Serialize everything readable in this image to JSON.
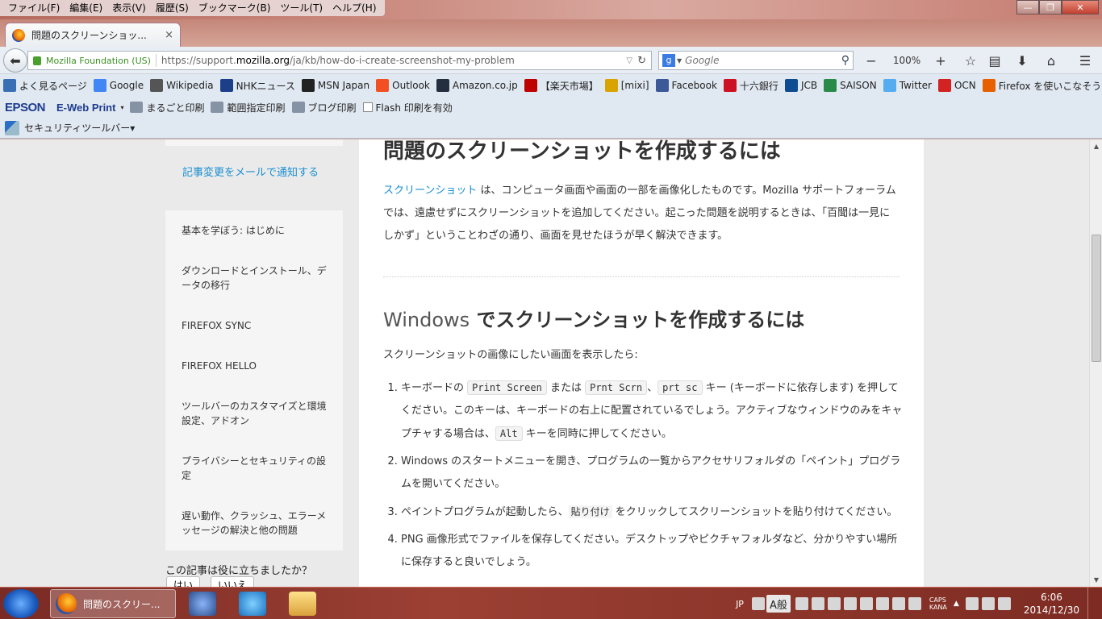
{
  "menu": [
    "ファイル(F)",
    "編集(E)",
    "表示(V)",
    "履歴(S)",
    "ブックマーク(B)",
    "ツール(T)",
    "ヘルプ(H)"
  ],
  "window_controls": {
    "minimize": "—",
    "maximize": "❐",
    "close": "✕"
  },
  "tab": {
    "title": "問題のスクリーンショッ...",
    "close": "×",
    "new": "+"
  },
  "nav": {
    "identity": "Mozilla Foundation (US)",
    "url_prefix": "https://support.",
    "url_domain": "mozilla.org",
    "url_path": "/ja/kb/how-do-i-create-screenshot-my-problem",
    "search_placeholder": "Google",
    "zoom": "100%"
  },
  "bookmarks": [
    {
      "label": "よく見るページ",
      "icon": "page-icon",
      "color": "#3b6fb5"
    },
    {
      "label": "Google",
      "icon": "google-icon",
      "color": "#4285f4"
    },
    {
      "label": "Wikipedia",
      "icon": "wikipedia-icon",
      "color": "#555555"
    },
    {
      "label": "NHKニュース",
      "icon": "nhk-icon",
      "color": "#1d3f8a"
    },
    {
      "label": "MSN Japan",
      "icon": "msn-icon",
      "color": "#222222"
    },
    {
      "label": "Outlook",
      "icon": "windows-icon",
      "color": "#f25022"
    },
    {
      "label": "Amazon.co.jp",
      "icon": "amazon-icon",
      "color": "#232f3e"
    },
    {
      "label": "【楽天市場】",
      "icon": "rakuten-icon",
      "color": "#bf0000"
    },
    {
      "label": "[mixi]",
      "icon": "mixi-icon",
      "color": "#d9a400"
    },
    {
      "label": "Facebook",
      "icon": "facebook-icon",
      "color": "#3b5998"
    },
    {
      "label": "十六銀行",
      "icon": "bank-icon",
      "color": "#cc1122"
    },
    {
      "label": "JCB",
      "icon": "jcb-icon",
      "color": "#0e4c92"
    },
    {
      "label": "SAISON",
      "icon": "saison-icon",
      "color": "#2a8a4a"
    },
    {
      "label": "Twitter",
      "icon": "twitter-icon",
      "color": "#55acee"
    },
    {
      "label": "OCN",
      "icon": "ocn-icon",
      "color": "#d22222"
    },
    {
      "label": "Firefox を使いこなそう",
      "icon": "firefox-icon",
      "color": "#e66000"
    }
  ],
  "epson": {
    "logo": "EPSON",
    "eweb": "E-Web Print",
    "items": [
      "まるごと印刷",
      "範囲指定印刷",
      "ブログ印刷",
      "Flash 印刷を有効"
    ]
  },
  "security_toolbar": "セキュリティツールバー▾",
  "sidebar": {
    "notify": "記事変更をメールで通知する",
    "items": [
      "基本を学ぼう: はじめに",
      "ダウンロードとインストール、データの移行",
      "FIREFOX SYNC",
      "FIREFOX HELLO",
      "ツールバーのカスタマイズと環境設定、アドオン",
      "プライバシーとセキュリティの設定",
      "遅い動作、クラッシュ、エラーメッセージの解決と他の問題"
    ],
    "helpful": "この記事は役に立ちましたか？",
    "yes": "はい",
    "no": "いいえ"
  },
  "article": {
    "title": "問題のスクリーンショットを作成するには",
    "intro_link": "スクリーンショット",
    "intro_text": " は、コンピュータ画面や画面の一部を画像化したものです。Mozilla サポートフォーラムでは、遠慮せずにスクリーンショットを追加してください。起こった問題を説明するときは、「百聞は一見にしかず」ということわざの通り、画面を見せたほうが早く解決できます。",
    "h2_win": "Windows",
    "h2_rest": " でスクリーンショットを作成するには",
    "lead": "スクリーンショットの画像にしたい画面を表示したら:",
    "step1_a": "キーボードの ",
    "key_print": "Print Screen",
    "step1_b": " または ",
    "key_prnt": "Prnt Scrn",
    "step1_c": "、",
    "key_prt": "prt sc",
    "step1_d": " キー (キーボードに依存します) を押してください。このキーは、キーボードの右上に配置されているでしょう。アクティブなウィンドウのみをキャプチャする場合は、",
    "key_alt": "Alt",
    "step1_e": " キーを同時に押してください。",
    "step2": "Windows のスタートメニューを開き、プログラムの一覧からアクセサリフォルダの「ペイント」プログラムを開いてください。",
    "step3_a": "ペイントプログラムが起動したら、",
    "paste": "貼り付け",
    "step3_b": " をクリックしてスクリーンショットを貼り付けてください。",
    "step4": "PNG 画像形式でファイルを保存してください。デスクトップやピクチャフォルダなど、分かりやすい場所に保存すると良いでしょう。"
  },
  "taskbar": {
    "active_title": "問題のスクリー...",
    "lang": "JP",
    "ime": "A般",
    "caps": "CAPS",
    "kana": "KANA",
    "time": "6:06",
    "date": "2014/12/30"
  }
}
